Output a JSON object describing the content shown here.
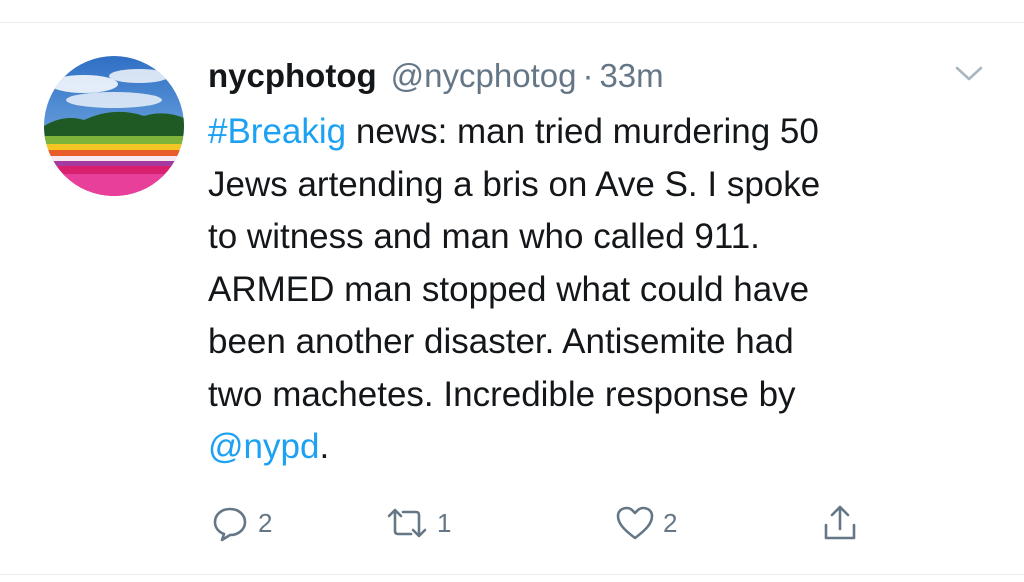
{
  "tweet": {
    "display_name": "nycphotog",
    "handle": "@nycphotog",
    "separator": "·",
    "time": "33m",
    "lines": [
      [
        {
          "text": "#Breakig",
          "link": true
        },
        {
          "text": " news: man tried murdering 50",
          "link": false
        }
      ],
      [
        {
          "text": "Jews artending a bris on Ave S.  I spoke",
          "link": false
        }
      ],
      [
        {
          "text": "to witness and man who called 911.",
          "link": false
        }
      ],
      [
        {
          "text": "ARMED man stopped what could have",
          "link": false
        }
      ],
      [
        {
          "text": "been another disaster.  Antisemite had",
          "link": false
        }
      ],
      [
        {
          "text": "two machetes. Incredible response by",
          "link": false
        }
      ],
      [
        {
          "text": "@nypd",
          "link": true
        },
        {
          "text": ".",
          "link": false
        }
      ]
    ]
  },
  "actions": {
    "reply_count": "2",
    "retweet_count": "1",
    "like_count": "2"
  },
  "icons": {
    "avatar": "flower-field-photo",
    "menu": "chevron-down-icon",
    "reply": "reply-icon",
    "retweet": "retweet-icon",
    "like": "heart-icon",
    "share": "share-icon"
  },
  "colors": {
    "text": "#14171a",
    "secondary": "#657786",
    "link": "#1da1f2",
    "border": "#e6ecf0"
  }
}
